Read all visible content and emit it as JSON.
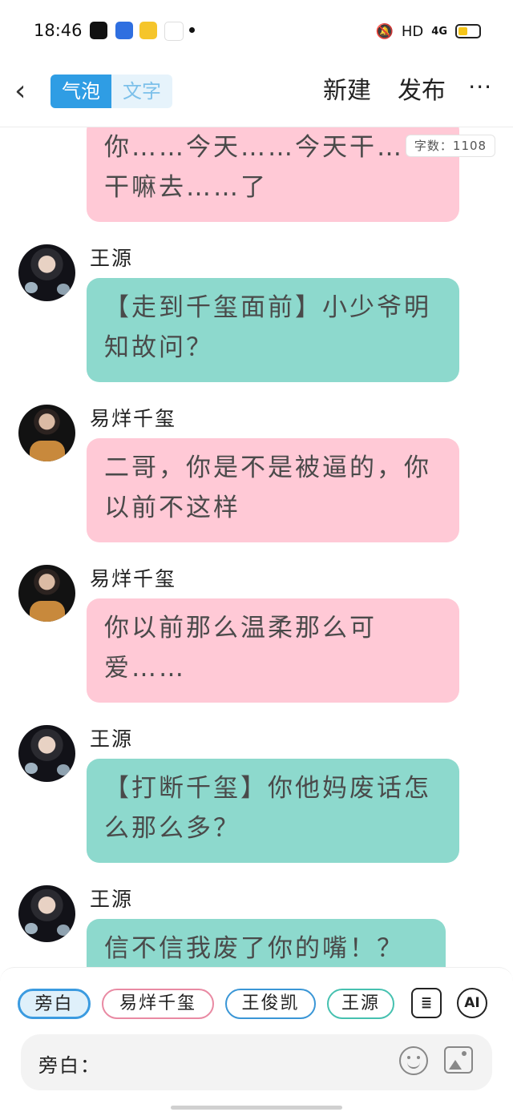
{
  "status_bar": {
    "time": "18:46",
    "network": "HD",
    "signal": "4G",
    "app_icons": [
      "tiktok-icon",
      "baidu-icon",
      "notes-icon",
      "58-icon"
    ]
  },
  "header": {
    "tabs": [
      "气泡",
      "文字"
    ],
    "active_tab": "气泡",
    "new_label": "新建",
    "publish_label": "发布",
    "more_label": "···"
  },
  "word_count": "字数：1108",
  "messages": [
    {
      "speaker": "",
      "text": "你……今天……今天干……干嘛去……了",
      "color": "#ffc9d6"
    },
    {
      "speaker": "王源",
      "text": "【走到千玺面前】小少爷明知故问？",
      "color": "#8dd9cd"
    },
    {
      "speaker": "易烊千玺",
      "text": "二哥，你是不是被逼的，你以前不这样",
      "color": "#ffc9d6"
    },
    {
      "speaker": "易烊千玺",
      "text": "你以前那么温柔那么可爱……",
      "color": "#ffc9d6"
    },
    {
      "speaker": "王源",
      "text": "【打断千玺】你他妈废话怎么那么多？",
      "color": "#8dd9cd"
    },
    {
      "speaker": "王源",
      "text": "信不信我废了你的嘴！？",
      "color": "#8dd9cd"
    }
  ],
  "characters": [
    {
      "label": "旁白",
      "selected": true
    },
    {
      "label": "易烊千玺",
      "selected": false
    },
    {
      "label": "王俊凯",
      "selected": false
    },
    {
      "label": "王源",
      "selected": false
    }
  ],
  "tools": {
    "card_icon": "contact-card-icon",
    "ai_label": "AI"
  },
  "input": {
    "label": "旁白："
  }
}
